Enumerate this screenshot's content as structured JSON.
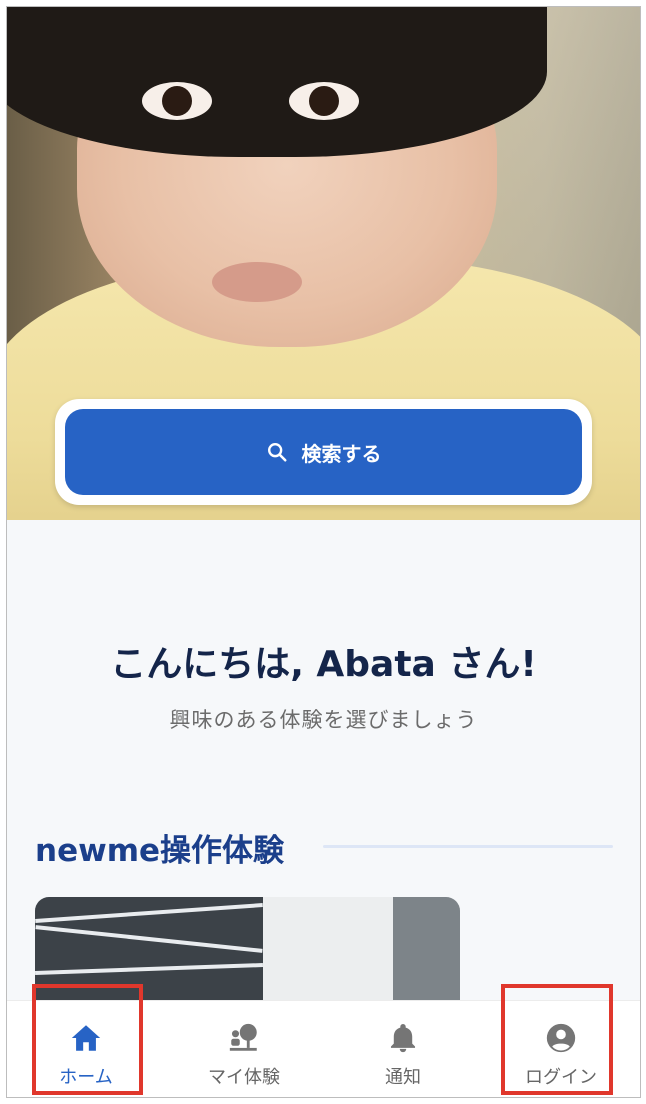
{
  "hero": {
    "search_label": "検索する",
    "search_icon": "search-icon"
  },
  "greeting": {
    "title": "こんにちは, Abata さん!",
    "subtitle": "興味のある体験を選びましょう"
  },
  "section": {
    "title": "newme操作体験"
  },
  "bottom_nav": {
    "items": [
      {
        "label": "ホーム",
        "icon": "home-icon",
        "active": true
      },
      {
        "label": "マイ体験",
        "icon": "my-experience-icon",
        "active": false
      },
      {
        "label": "通知",
        "icon": "bell-icon",
        "active": false
      },
      {
        "label": "ログイン",
        "icon": "account-circle-icon",
        "active": false
      }
    ]
  },
  "colors": {
    "primary": "#2763c5",
    "heading": "#14254a",
    "section": "#1b3f8b",
    "highlight": "#e0372c"
  }
}
